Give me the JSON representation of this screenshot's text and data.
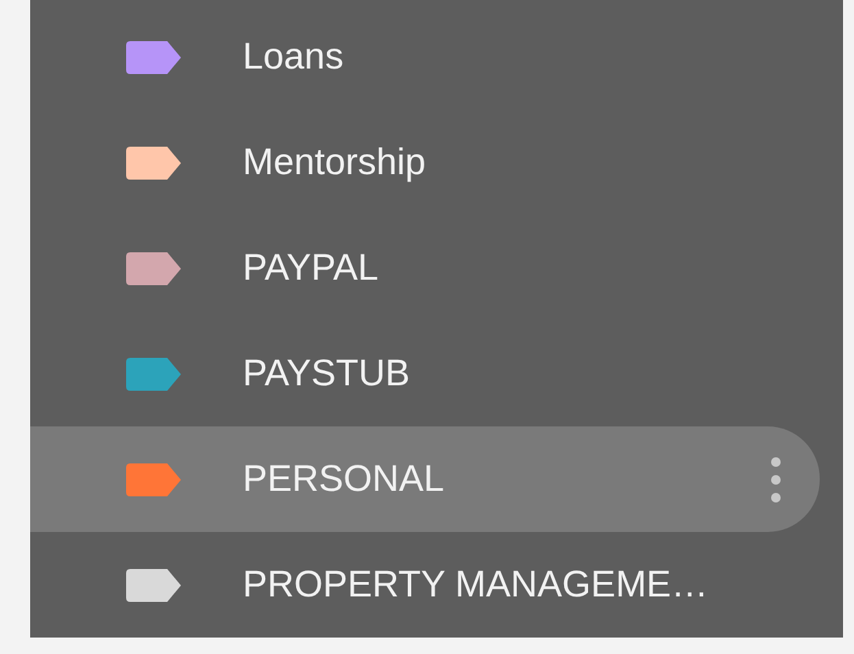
{
  "labels": [
    {
      "label": "Loans",
      "color": "#b694f8",
      "selected": false
    },
    {
      "label": "Mentorship",
      "color": "#ffc6aa",
      "selected": false
    },
    {
      "label": "PAYPAL",
      "color": "#d3a7ad",
      "selected": false
    },
    {
      "label": "PAYSTUB",
      "color": "#2ca3ba",
      "selected": false
    },
    {
      "label": "PERSONAL",
      "color": "#ff7537",
      "selected": true
    },
    {
      "label": "PROPERTY MANAGEME…",
      "color": "#d9d9d9",
      "selected": false
    }
  ]
}
